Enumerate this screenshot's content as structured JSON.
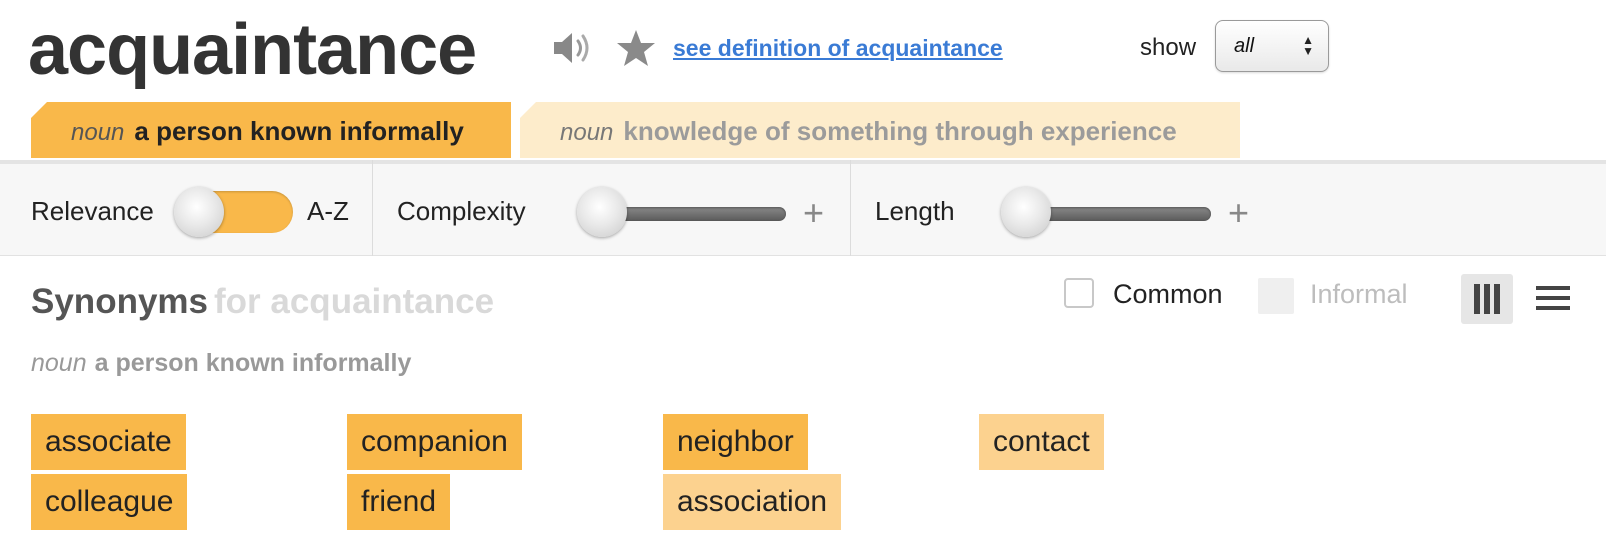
{
  "header": {
    "word": "acquaintance",
    "definition_link": "see definition of acquaintance",
    "show_label": "show",
    "show_value": "all",
    "icons": {
      "audio": "speaker-icon",
      "favorite": "star-icon"
    }
  },
  "senses": [
    {
      "pos": "noun",
      "definition": "a person known informally"
    },
    {
      "pos": "noun",
      "definition": "knowledge of something through experience"
    }
  ],
  "filters": {
    "sort_left": "Relevance",
    "sort_right": "A-Z",
    "complexity": "Complexity",
    "length": "Length",
    "plus": "+"
  },
  "results": {
    "title": "Synonyms",
    "title_suffix": "for acquaintance",
    "sense_pos": "noun",
    "sense_def": "a person known informally",
    "common_label": "Common",
    "informal_label": "Informal",
    "common_checked": false
  },
  "synonyms": [
    {
      "word": "associate",
      "strength": "strong"
    },
    {
      "word": "colleague",
      "strength": "strong"
    },
    {
      "word": "companion",
      "strength": "strong"
    },
    {
      "word": "friend",
      "strength": "strong"
    },
    {
      "word": "neighbor",
      "strength": "strong"
    },
    {
      "word": "association",
      "strength": "light"
    },
    {
      "word": "contact",
      "strength": "light"
    }
  ],
  "colors": {
    "accent": "#f9b84a",
    "accent_light": "#fcd28f",
    "tab_inactive": "#fdeccb",
    "link": "#3a7bd5"
  }
}
